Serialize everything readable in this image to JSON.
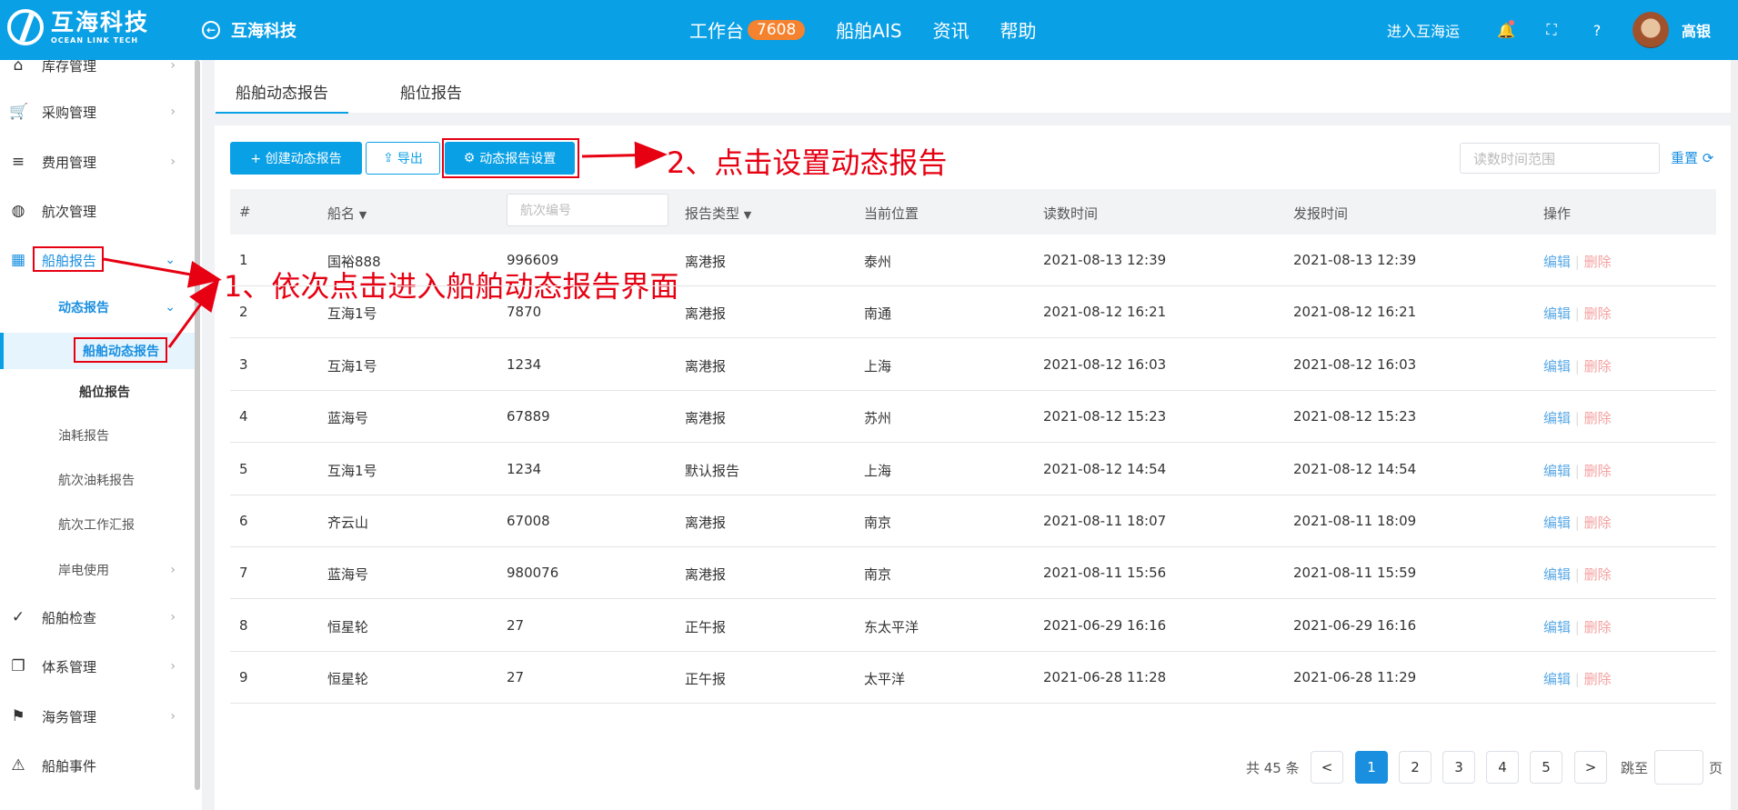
{
  "header": {
    "logo_title": "互海科技",
    "logo_sub": "OCEAN LINK TECH",
    "back_label": "互海科技",
    "nav": [
      {
        "label": "工作台",
        "badge": "7608"
      },
      {
        "label": "船舶AIS"
      },
      {
        "label": "资讯"
      },
      {
        "label": "帮助"
      }
    ],
    "enter_label": "进入互海运",
    "user_name": "高银",
    "accent_color": "#0aa0e6"
  },
  "sidebar": {
    "items": [
      {
        "label": "库存管理",
        "icon": "warehouse-icon"
      },
      {
        "label": "采购管理",
        "icon": "cart-icon"
      },
      {
        "label": "费用管理",
        "icon": "database-icon"
      },
      {
        "label": "航次管理",
        "icon": "globe-icon"
      },
      {
        "label": "船舶报告",
        "icon": "calendar-icon"
      },
      {
        "label": "动态报告"
      },
      {
        "label": "船舶动态报告"
      },
      {
        "label": "船位报告"
      },
      {
        "label": "油耗报告"
      },
      {
        "label": "航次油耗报告"
      },
      {
        "label": "航次工作汇报"
      },
      {
        "label": "岸电使用"
      },
      {
        "label": "船舶检查",
        "icon": "check-circle-icon"
      },
      {
        "label": "体系管理",
        "icon": "document-icon"
      },
      {
        "label": "海务管理",
        "icon": "signpost-icon"
      },
      {
        "label": "船舶事件",
        "icon": "warning-icon"
      }
    ]
  },
  "tabs": [
    "船舶动态报告",
    "船位报告"
  ],
  "toolbar": {
    "create_label": "+ 创建动态报告",
    "export_label": "导出",
    "settings_label": "动态报告设置",
    "date_placeholder": "读数时间范围",
    "reset_label": "重置"
  },
  "annotations": {
    "step1": "1、依次点击进入船舶动态报告界面",
    "step2": "2、点击设置动态报告"
  },
  "table": {
    "headers": [
      "#",
      "船名",
      "报告类型",
      "当前位置",
      "读数时间",
      "发报时间",
      "操作"
    ],
    "voyage_placeholder": "航次编号",
    "edit_label": "编辑",
    "delete_label": "删除",
    "rows": [
      {
        "no": "1",
        "ship": "国裕888",
        "voyage": "996609",
        "type": "离港报",
        "pos": "泰州",
        "read": "2021-08-13 12:39",
        "sent": "2021-08-13 12:39"
      },
      {
        "no": "2",
        "ship": "互海1号",
        "voyage": "7870",
        "type": "离港报",
        "pos": "南通",
        "read": "2021-08-12 16:21",
        "sent": "2021-08-12 16:21"
      },
      {
        "no": "3",
        "ship": "互海1号",
        "voyage": "1234",
        "type": "离港报",
        "pos": "上海",
        "read": "2021-08-12 16:03",
        "sent": "2021-08-12 16:03"
      },
      {
        "no": "4",
        "ship": "蓝海号",
        "voyage": "67889",
        "type": "离港报",
        "pos": "苏州",
        "read": "2021-08-12 15:23",
        "sent": "2021-08-12 15:23"
      },
      {
        "no": "5",
        "ship": "互海1号",
        "voyage": "1234",
        "type": "默认报告",
        "pos": "上海",
        "read": "2021-08-12 14:54",
        "sent": "2021-08-12 14:54"
      },
      {
        "no": "6",
        "ship": "齐云山",
        "voyage": "67008",
        "type": "离港报",
        "pos": "南京",
        "read": "2021-08-11 18:07",
        "sent": "2021-08-11 18:09"
      },
      {
        "no": "7",
        "ship": "蓝海号",
        "voyage": "980076",
        "type": "离港报",
        "pos": "南京",
        "read": "2021-08-11 15:56",
        "sent": "2021-08-11 15:59"
      },
      {
        "no": "8",
        "ship": "恒星轮",
        "voyage": "27",
        "type": "正午报",
        "pos": "东太平洋",
        "read": "2021-06-29 16:16",
        "sent": "2021-06-29 16:16"
      },
      {
        "no": "9",
        "ship": "恒星轮",
        "voyage": "27",
        "type": "正午报",
        "pos": "太平洋",
        "read": "2021-06-28 11:28",
        "sent": "2021-06-28 11:29"
      }
    ]
  },
  "pagination": {
    "total": "共 45 条",
    "prev": "<",
    "next": ">",
    "pages": [
      "1",
      "2",
      "3",
      "4",
      "5"
    ],
    "goto": "跳至",
    "page_unit": "页"
  }
}
